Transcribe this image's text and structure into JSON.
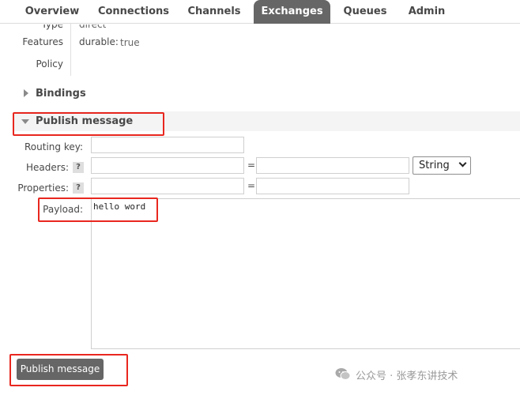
{
  "nav": {
    "tabs": [
      {
        "label": "Overview"
      },
      {
        "label": "Connections"
      },
      {
        "label": "Channels"
      },
      {
        "label": "Exchanges",
        "active": true
      },
      {
        "label": "Queues"
      },
      {
        "label": "Admin"
      }
    ]
  },
  "details": {
    "type_label": "Type",
    "type_value": "direct",
    "features_label": "Features",
    "durable_key": "durable:",
    "durable_value": "true",
    "policy_label": "Policy"
  },
  "bindings": {
    "label": "Bindings",
    "expanded": false
  },
  "publish": {
    "section_label": "Publish message",
    "expanded": true,
    "routing_key_label": "Routing key:",
    "routing_key_value": "",
    "headers_label": "Headers:",
    "headers_help": "?",
    "header_key_value": "",
    "header_value_value": "",
    "equals": "=",
    "header_type": "String",
    "header_type_options": [
      "String"
    ],
    "properties_label": "Properties:",
    "properties_help": "?",
    "property_key_value": "",
    "property_value_value": "",
    "payload_label": "Payload:",
    "payload_value": "hello word",
    "button_label": "Publish message"
  },
  "watermark": {
    "text": "公众号 · 张孝东讲技术"
  },
  "colors": {
    "annotation": "#e8271f",
    "tab_active": "#666666",
    "button": "#666666"
  }
}
